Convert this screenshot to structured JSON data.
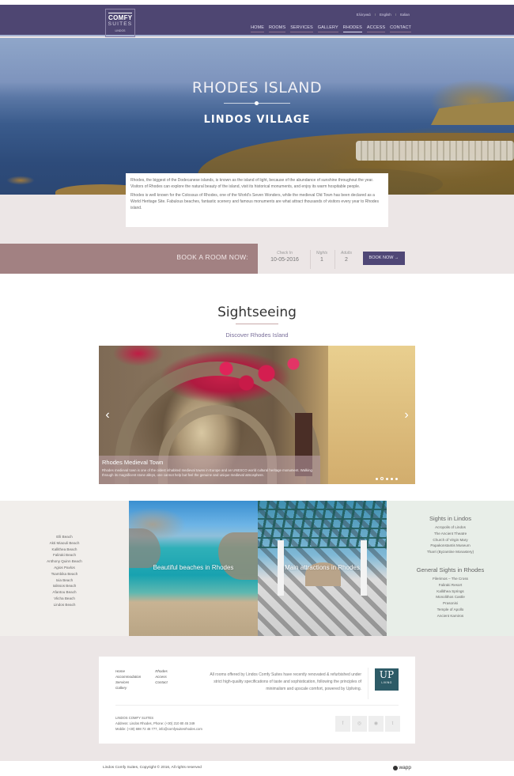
{
  "header": {
    "logo": {
      "line1": "COMFY",
      "line2": "SUITES",
      "line3": "LINDOS"
    },
    "languages": [
      "Ελληνικά",
      "English",
      "Italian"
    ],
    "nav": [
      {
        "label": "HOME",
        "active": false
      },
      {
        "label": "ROOMS",
        "active": false
      },
      {
        "label": "SERVICES",
        "active": false
      },
      {
        "label": "GALLERY",
        "active": false
      },
      {
        "label": "RHODES",
        "active": true
      },
      {
        "label": "ACCESS",
        "active": false
      },
      {
        "label": "CONTACT",
        "active": false
      }
    ]
  },
  "hero": {
    "title": "RHODES ISLAND",
    "subtitle": "LINDOS VILLAGE"
  },
  "intro": {
    "paragraphs": [
      "Rhodes, the biggest of the Dodecanese islands, is known as the island of light, because of the abundance of sunshine throughout the year. Visitors of Rhodes can explore the natural beauty of the island, visit its historical monuments, and enjoy its warm hospitable people.",
      "Rhodes is well known for the Colossus of Rhodes, one of the World's Seven Wonders, while the medieval Old Town has been declared as a World Heritage Site. Fabulous beaches, fantastic scenery and famous monuments are what attract thousands of visitors every year to Rhodes island."
    ]
  },
  "booking": {
    "label": "BOOK A ROOM NOW:",
    "checkin_label": "Check In",
    "checkin_value": "10-05-2016",
    "nights_label": "Nights",
    "nights_value": "1",
    "adults_label": "Adults",
    "adults_value": "2",
    "button": "BOOK NOW →"
  },
  "sightseeing": {
    "title": "Sightseeing",
    "subtitle": "Discover Rhodes Island",
    "slide": {
      "title": "Rhodes Medieval Town",
      "description": "Rhodes medieval town is one of the oldest inhabited medieval towns in Europe and an UNESCO world cultural heritage monument. Walking through its magnificent stone alleys, one cannot help but feel the genuine and unique medieval atmosphere.",
      "prev": "‹",
      "next": "›",
      "dot_count": 5,
      "active_dot": 2
    }
  },
  "beaches": [
    "Elli Beach",
    "Akti Miaouli Beach",
    "Kallithea Beach",
    "Faliraki Beach",
    "Anthony Quinn Beach",
    "Agios Pavlos",
    "Tsambika Beach",
    "Ixia Beach",
    "Ialissos Beach",
    "Afantou Beach",
    "Vlicha Beach",
    "Lindos Beach"
  ],
  "tiles": {
    "beaches_label": "Beautiful beaches in Rhodes",
    "attractions_label": "Main attractions in Rhodes"
  },
  "sights": {
    "lindos_title": "Sights in Lindos",
    "lindos": [
      "Acropolis of Lindos",
      "The Ancient Theatre",
      "Church of Virgin Mary",
      "Papakonstantis Museum",
      "Tharri (Byzantine Monastery)"
    ],
    "rhodes_title": "General Sights in Rhodes",
    "rhodes": [
      "Filerimos – The Cross",
      "Faliraki Resort",
      "Kallithea Springs",
      "Monolithos Castle",
      "Prasonisi",
      "Temple of Apollo",
      "Ancient Kamiros"
    ]
  },
  "footer": {
    "nav_col1": [
      "Home",
      "Accommodation",
      "Services",
      "Gallery"
    ],
    "nav_col2": [
      "Rhodes",
      "Access",
      "Contact"
    ],
    "description": "All rooms offered by Lindos Comfy Suites have recently renovated & refurbished under strict high-quality specifications of taste and sophistication, following the principles of minimalism and upscale comfort, powered by Upliving.",
    "uplogo": {
      "big": "UP",
      "small": "LIVING"
    },
    "company": "LINDOS COMFY SUITES",
    "address": "Address: Lindos Rhodes, Phone: (+30) 210 80 45 349",
    "mobile": "Mobile: (+30) 698 72 46 777, info@comfysuitesrhodes.com",
    "social": [
      {
        "name": "facebook",
        "glyph": "f"
      },
      {
        "name": "instagram",
        "glyph": "◎"
      },
      {
        "name": "tripadvisor",
        "glyph": "◉"
      },
      {
        "name": "twitter",
        "glyph": "t"
      }
    ],
    "copyright": "Lindos Comfy Suites, Copyright © 2016, All rights reserved",
    "brand": "wapp"
  }
}
